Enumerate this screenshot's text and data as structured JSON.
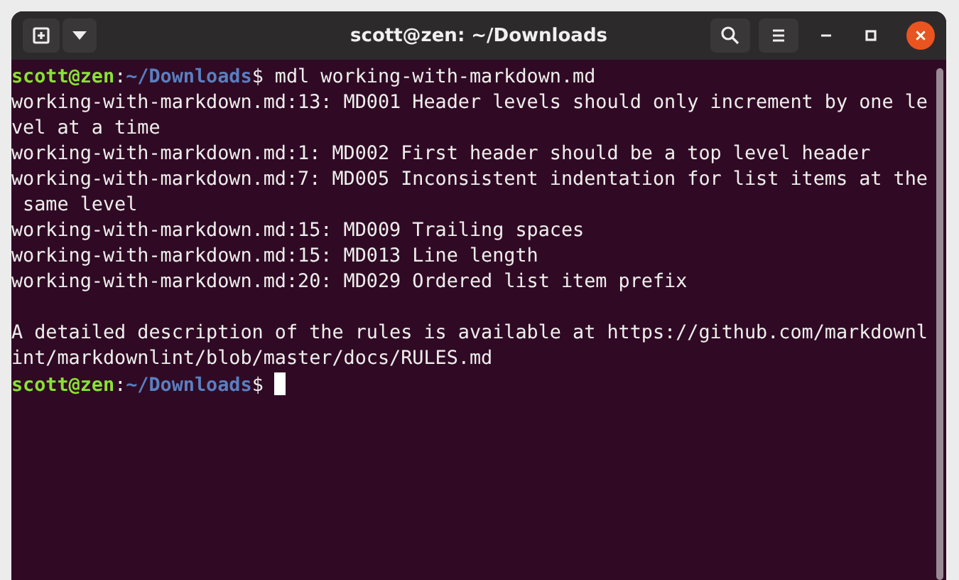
{
  "window": {
    "title": "scott@zen: ~/Downloads"
  },
  "terminal": {
    "lines": [
      {
        "kind": "prompt",
        "user": "scott@zen",
        "separator": ":",
        "path": "~/Downloads",
        "symbol": "$",
        "command": " mdl working-with-markdown.md",
        "cursor": false
      },
      {
        "kind": "output",
        "text": "working-with-markdown.md:13: MD001 Header levels should only increment by one le"
      },
      {
        "kind": "output",
        "text": "vel at a time"
      },
      {
        "kind": "output",
        "text": "working-with-markdown.md:1: MD002 First header should be a top level header"
      },
      {
        "kind": "output",
        "text": "working-with-markdown.md:7: MD005 Inconsistent indentation for list items at the"
      },
      {
        "kind": "output",
        "text": " same level"
      },
      {
        "kind": "output",
        "text": "working-with-markdown.md:15: MD009 Trailing spaces"
      },
      {
        "kind": "output",
        "text": "working-with-markdown.md:15: MD013 Line length"
      },
      {
        "kind": "output",
        "text": "working-with-markdown.md:20: MD029 Ordered list item prefix"
      },
      {
        "kind": "blank"
      },
      {
        "kind": "output",
        "text": "A detailed description of the rules is available at https://github.com/markdownl"
      },
      {
        "kind": "output",
        "text": "int/markdownlint/blob/master/docs/RULES.md"
      },
      {
        "kind": "prompt",
        "user": "scott@zen",
        "separator": ":",
        "path": "~/Downloads",
        "symbol": "$",
        "cursor": true
      }
    ]
  }
}
